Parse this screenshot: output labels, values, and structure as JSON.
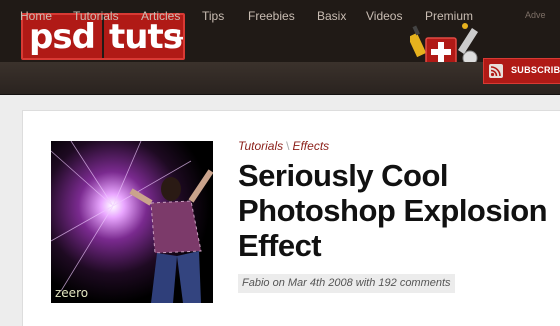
{
  "logo": {
    "part1": "psd",
    "part2": "tuts",
    "plus": "+"
  },
  "header": {
    "advertise_label": "Adve"
  },
  "nav": {
    "items": [
      {
        "label": "Home"
      },
      {
        "label": "Tutorials"
      },
      {
        "label": "Articles"
      },
      {
        "label": "Tips"
      },
      {
        "label": "Freebies"
      },
      {
        "label": "Basix"
      },
      {
        "label": "Videos"
      },
      {
        "label": "Premium"
      }
    ],
    "subscribe_label": "SUBSCRIBE"
  },
  "article": {
    "breadcrumb": {
      "category": "Tutorials",
      "separator": "\\",
      "subcategory": "Effects"
    },
    "title": "Seriously Cool Photoshop Explosion Effect",
    "meta": {
      "author": "Fabio",
      "on": " on ",
      "date": "Mar 4th 2008",
      "with": " with ",
      "comments": "192 comments"
    },
    "thumbnail_text": "zeero"
  },
  "colors": {
    "brand_red": "#b01a16",
    "header_dark": "#201a16",
    "breadcrumb": "#8b1e18"
  }
}
